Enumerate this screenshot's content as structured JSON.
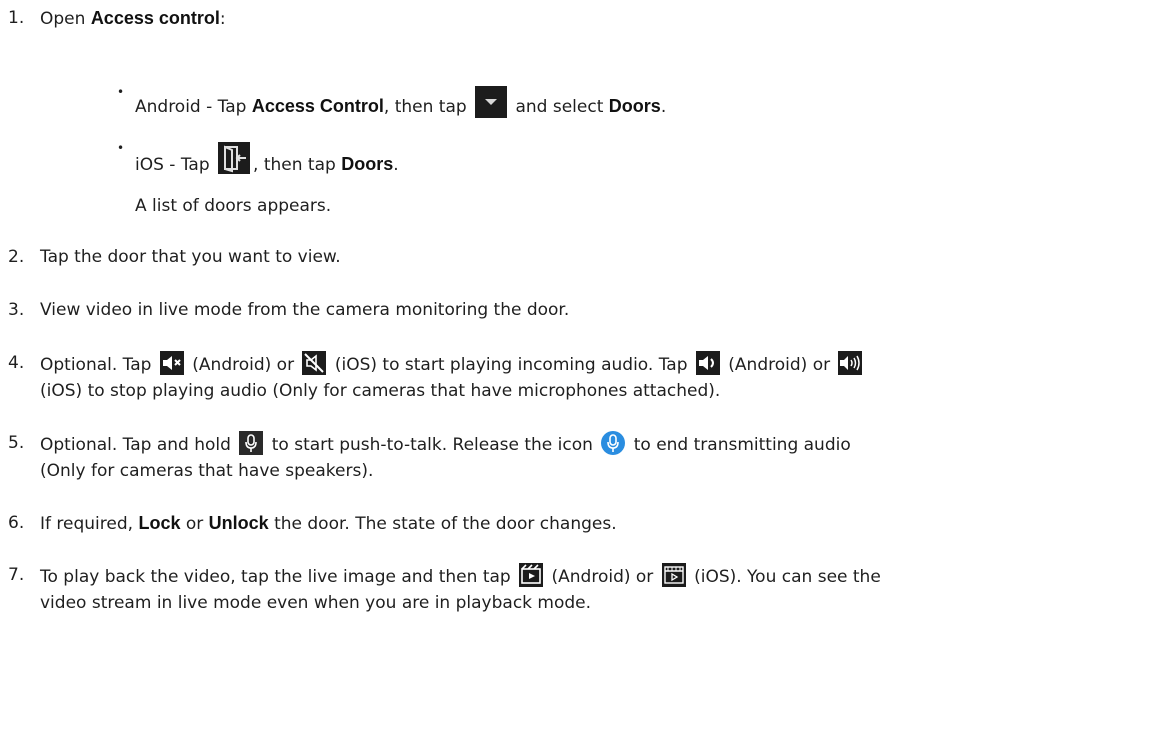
{
  "steps": [
    {
      "number": "1.",
      "prefix": "Open ",
      "bold": "Access control",
      "suffix": ":",
      "sub": [
        {
          "platform": "Android",
          "part1": " - Tap ",
          "bold1": "Access Control",
          "part2": ", then tap ",
          "icon": "dropdown-arrow-icon",
          "part3": " and select ",
          "bold2": "Doors",
          "part4": "."
        },
        {
          "platform": "iOS",
          "part1": " - Tap ",
          "icon": "door-exit-icon",
          "part2": ", then tap ",
          "bold1": "Doors",
          "part3": "."
        }
      ],
      "note": "A list of doors appears."
    },
    {
      "number": "2.",
      "text": "Tap the door that you want to view."
    },
    {
      "number": "3.",
      "text": "View video in live mode from the camera monitoring the door."
    },
    {
      "number": "4.",
      "line1": {
        "a": "Optional. Tap ",
        "icon1": "speaker-muted-android-icon",
        "b": " (Android) or ",
        "icon2": "speaker-muted-ios-icon",
        "c": " (iOS) to start playing incoming audio. Tap ",
        "icon3": "speaker-on-android-icon",
        "d": " (Android) or ",
        "icon4": "speaker-on-ios-icon"
      },
      "line2": "(iOS) to stop playing audio (Only for cameras that have microphones attached)."
    },
    {
      "number": "5.",
      "line1": {
        "a": "Optional. Tap and hold ",
        "icon1": "microphone-icon",
        "b": " to start push-to-talk. Release the icon ",
        "icon2": "microphone-active-icon",
        "c": " to end transmitting audio"
      },
      "line2": "(Only for cameras that have speakers)."
    },
    {
      "number": "6.",
      "a": "If required, ",
      "bold1": "Lock",
      "b": " or ",
      "bold2": "Unlock",
      "c": " the door. The state of the door changes."
    },
    {
      "number": "7.",
      "line1": {
        "a": "To play back the video, tap the live image and then tap ",
        "icon1": "playback-android-icon",
        "b": " (Android) or ",
        "icon2": "playback-ios-icon",
        "c": " (iOS). You can see the"
      },
      "line2": "video stream in live mode even when you are in playback mode."
    }
  ],
  "colors": {
    "text": "#1f1f1f",
    "icon_dark": "#1c1c1c",
    "icon_mic_blue": "#2a8de0"
  }
}
